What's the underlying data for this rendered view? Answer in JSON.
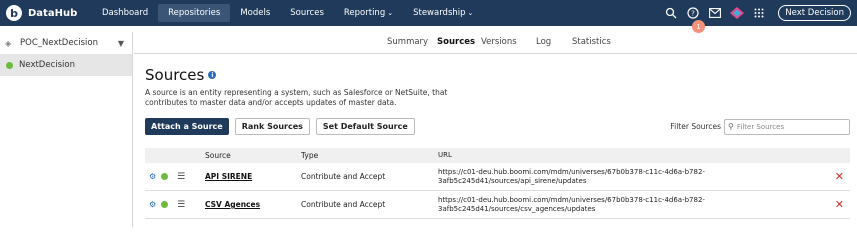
{
  "app": {
    "name": "DataHub"
  },
  "nav": {
    "items": [
      {
        "label": "Dashboard",
        "active": false
      },
      {
        "label": "Repositories",
        "active": true
      },
      {
        "label": "Models",
        "active": false
      },
      {
        "label": "Sources",
        "active": false
      },
      {
        "label": "Reporting",
        "active": false,
        "dropdown": true
      },
      {
        "label": "Stewardship",
        "active": false,
        "dropdown": true
      }
    ],
    "notification_count": "1",
    "user_button": "Next Decision"
  },
  "sidebar": {
    "repository": "POC_NextDecision",
    "environment": "NextDecision"
  },
  "subtabs": [
    "Summary",
    "Sources",
    "Versions",
    "Log",
    "Statistics"
  ],
  "page": {
    "title": "Sources",
    "description": "A source is an entity representing a system, such as Salesforce or NetSuite, that contributes to master data and/or accepts updates of master data.",
    "buttons": {
      "attach": "Attach a Source",
      "rank": "Rank Sources",
      "default": "Set Default Source"
    },
    "filter": {
      "label": "Filter Sources",
      "placeholder": "Filter Sources"
    }
  },
  "table": {
    "headers": {
      "source": "Source",
      "type": "Type",
      "url": "URL"
    },
    "rows": [
      {
        "source": "API SIRENE",
        "type": "Contribute and Accept",
        "url_line1": "https://c01-deu.hub.boomi.com/mdm/universes/67b0b378-c11c-4d6a-b782-",
        "url_line2": "3afb5c245d41/sources/api_sirene/updates"
      },
      {
        "source": "CSV Agences",
        "type": "Contribute and Accept",
        "url_line1": "https://c01-deu.hub.boomi.com/mdm/universes/67b0b378-c11c-4d6a-b782-",
        "url_line2": "3afb5c245d41/sources/csv_agences/updates"
      }
    ]
  },
  "icons": {
    "search": "search-icon",
    "help": "help-icon",
    "mail": "mail-icon",
    "apps": "grid-icon"
  },
  "colors": {
    "nav_bg": "#1f3a5a",
    "accent": "#2a6ebb",
    "status_green": "#6cbb3c",
    "delete_red": "#d0302a",
    "badge": "#f4917b"
  }
}
